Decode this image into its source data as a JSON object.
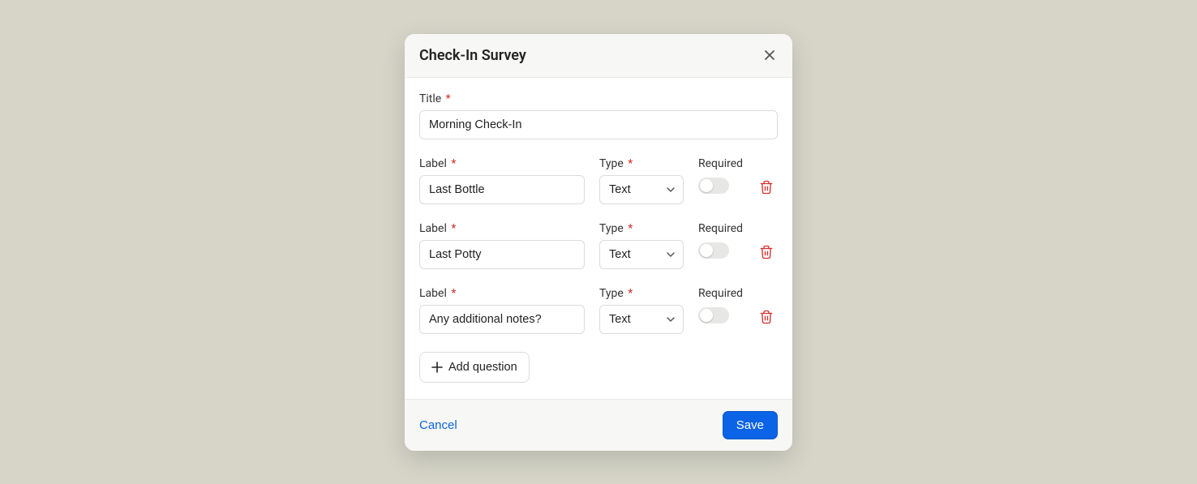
{
  "modal": {
    "title": "Check-In Survey"
  },
  "titleField": {
    "label": "Title",
    "value": "Morning Check-In"
  },
  "columnHeaders": {
    "label": "Label",
    "type": "Type",
    "required": "Required"
  },
  "questions": [
    {
      "label": "Last Bottle",
      "type": "Text",
      "required": false
    },
    {
      "label": "Last Potty",
      "type": "Text",
      "required": false
    },
    {
      "label": "Any additional notes?",
      "type": "Text",
      "required": false
    }
  ],
  "buttons": {
    "addQuestion": "Add question",
    "cancel": "Cancel",
    "save": "Save"
  },
  "requiredMark": "*"
}
